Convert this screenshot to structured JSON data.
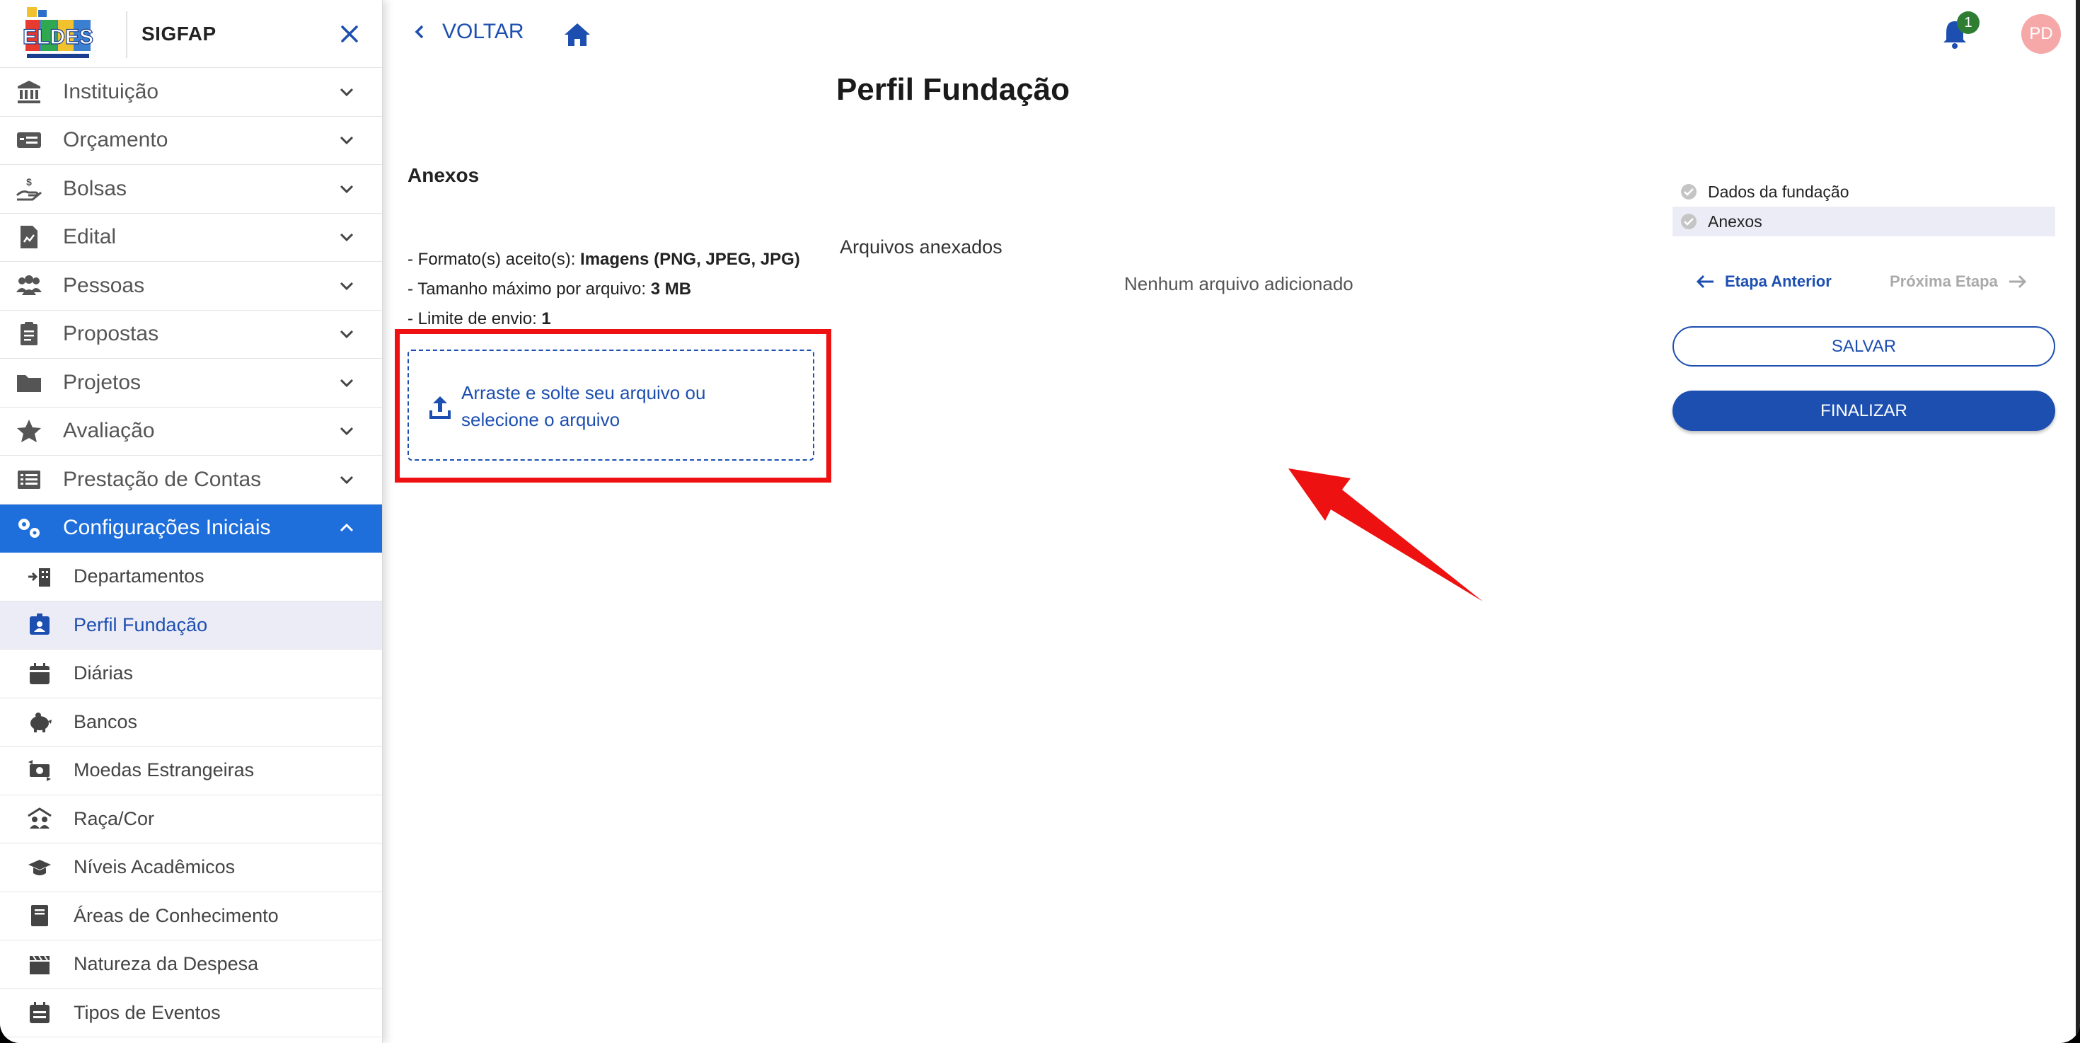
{
  "app": {
    "name": "SIGFAP",
    "avatar_initials": "PD",
    "notification_count": "1"
  },
  "sidebar": {
    "menu": [
      {
        "label": "Instituição",
        "icon": "bank-icon"
      },
      {
        "label": "Orçamento",
        "icon": "money-icon"
      },
      {
        "label": "Bolsas",
        "icon": "hand-coin-icon"
      },
      {
        "label": "Edital",
        "icon": "document-icon"
      },
      {
        "label": "Pessoas",
        "icon": "people-icon"
      },
      {
        "label": "Propostas",
        "icon": "clipboard-icon"
      },
      {
        "label": "Projetos",
        "icon": "folder-icon"
      },
      {
        "label": "Avaliação",
        "icon": "star-icon"
      },
      {
        "label": "Prestação de Contas",
        "icon": "list-icon"
      },
      {
        "label": "Configurações Iniciais",
        "icon": "gears-icon",
        "active": true
      }
    ],
    "submenu": [
      {
        "label": "Departamentos",
        "icon": "department-icon"
      },
      {
        "label": "Perfil Fundação",
        "icon": "id-badge-icon",
        "selected": true
      },
      {
        "label": "Diárias",
        "icon": "calendar-icon"
      },
      {
        "label": "Bancos",
        "icon": "piggy-bank-icon"
      },
      {
        "label": "Moedas Estrangeiras",
        "icon": "currency-exchange-icon"
      },
      {
        "label": "Raça/Cor",
        "icon": "people-roof-icon"
      },
      {
        "label": "Níveis Acadêmicos",
        "icon": "graduation-cap-icon"
      },
      {
        "label": "Áreas de Conhecimento",
        "icon": "book-icon"
      },
      {
        "label": "Natureza da Despesa",
        "icon": "clapperboard-icon"
      },
      {
        "label": "Tipos de Eventos",
        "icon": "calendar-list-icon"
      }
    ]
  },
  "header": {
    "back_label": "VOLTAR"
  },
  "page": {
    "title": "Perfil Fundação",
    "section_title": "Anexos",
    "info": {
      "formats_label": "- Formato(s) aceito(s): ",
      "formats_value": "Imagens (PNG, JPEG, JPG)",
      "max_size_label": "- Tamanho máximo por arquivo: ",
      "max_size_value": "3 MB",
      "limit_label": "- Limite de envio: ",
      "limit_value": "1"
    },
    "dropzone_text": "Arraste e solte seu arquivo ou selecione o arquivo",
    "attached_title": "Arquivos anexados",
    "no_files": "Nenhum arquivo adicionado"
  },
  "steps": [
    {
      "label": "Dados da fundação"
    },
    {
      "label": "Anexos",
      "current": true
    }
  ],
  "nav": {
    "prev": "Etapa Anterior",
    "next": "Próxima Etapa"
  },
  "buttons": {
    "save": "SALVAR",
    "finish": "FINALIZAR"
  },
  "colors": {
    "primary": "#1d4fb0",
    "active_menu": "#1e6fdb",
    "highlight": "#ee1111"
  }
}
